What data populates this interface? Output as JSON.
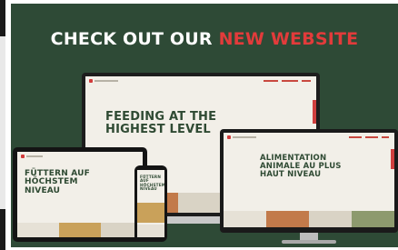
{
  "headline": {
    "part1": "CHECK OUT OUR ",
    "part2": "NEW WEBSITE"
  },
  "laptop": {
    "hero_title": "FEEDING AT THE\nHIGHEST LEVEL"
  },
  "tablet": {
    "hero_title": "FÜTTERN AUF\nHÖCHSTEM\nNIVEAU"
  },
  "phone": {
    "hero_title": "FÜTTERN AUF\nHÖCHSTEM\nNIVEAU"
  },
  "monitor": {
    "hero_title": "ALIMENTATION\nANIMALE AU PLUS\nHAUT NIVEAU"
  },
  "colors": {
    "banner": "#2e4a36",
    "accent": "#e23b3b",
    "site_green": "#2f4a33"
  }
}
